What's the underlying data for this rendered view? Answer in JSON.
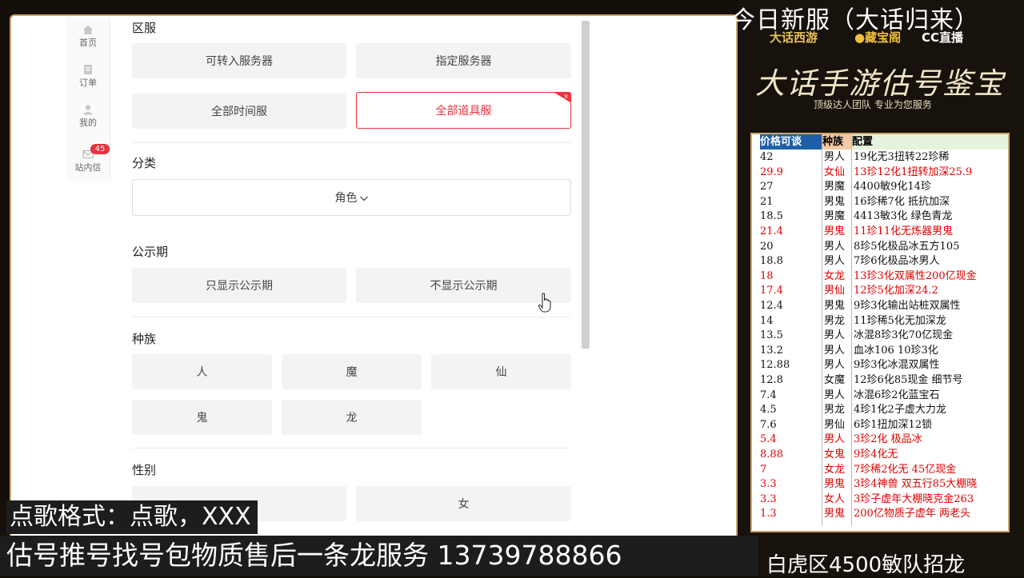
{
  "stream_title": "今日新服（大话归来）",
  "logos": [
    {
      "text": "大话西游",
      "color": "#e8c35a"
    },
    {
      "text": "藏宝阁",
      "color": "#f0c040"
    },
    {
      "text": "CC直播",
      "color": "#ffffff"
    }
  ],
  "brand_title": "大话手游估号鉴宝",
  "brand_subtitle": "顶级达人团队 专业为您服务",
  "nav": {
    "items": [
      {
        "label": "首页",
        "icon": "home-icon"
      },
      {
        "label": "订单",
        "icon": "order-icon"
      },
      {
        "label": "我的",
        "icon": "user-icon"
      },
      {
        "label": "站内信",
        "icon": "mail-icon",
        "badge": "45"
      }
    ]
  },
  "filters": {
    "server": {
      "title": "区服",
      "options": [
        "可转入服务器",
        "指定服务器",
        "全部时间服",
        "全部道具服"
      ],
      "selected": "全部道具服",
      "selected_mark": "×"
    },
    "category": {
      "title": "分类",
      "value": "角色"
    },
    "public_period": {
      "title": "公示期",
      "options": [
        "只显示公示期",
        "不显示公示期"
      ]
    },
    "race": {
      "title": "种族",
      "options": [
        "人",
        "魔",
        "仙",
        "鬼",
        "龙"
      ]
    },
    "gender": {
      "title": "性别",
      "options": [
        "女"
      ]
    }
  },
  "price_table": {
    "headers": [
      "价格可谈",
      "种族",
      "配置"
    ],
    "header_colors": [
      "#1d5fa8",
      "#f5c9a6",
      "#e6f3dc"
    ],
    "highlight_color": "#e00000",
    "rows": [
      {
        "price": "42",
        "race": "男人",
        "config": "19化无3扭转22珍稀",
        "red": false
      },
      {
        "price": "29.9",
        "race": "女仙",
        "config": "13珍12化1扭转加深25.9",
        "red": true
      },
      {
        "price": "27",
        "race": "男魔",
        "config": "4400敏9化14珍",
        "red": false
      },
      {
        "price": "21",
        "race": "男鬼",
        "config": "16珍稀7化 抵抗加深",
        "red": false
      },
      {
        "price": "18.5",
        "race": "男魔",
        "config": "4413敏3化 绿色青龙",
        "red": false
      },
      {
        "price": "21.4",
        "race": "男鬼",
        "config": "11珍11化无炼器男鬼",
        "red": true
      },
      {
        "price": "20",
        "race": "男人",
        "config": "8珍5化极品冰五方105",
        "red": false
      },
      {
        "price": "18.8",
        "race": "男人",
        "config": "7珍6化极品冰男人",
        "red": false
      },
      {
        "price": "18",
        "race": "女龙",
        "config": "13珍3化双属性200亿现金",
        "red": true
      },
      {
        "price": "17.4",
        "race": "男仙",
        "config": "12珍5化加深24.2",
        "red": true
      },
      {
        "price": "12.4",
        "race": "男鬼",
        "config": "9珍3化输出站桩双属性",
        "red": false
      },
      {
        "price": "14",
        "race": "男龙",
        "config": "11珍稀5化无加深龙",
        "red": false
      },
      {
        "price": "13.5",
        "race": "男人",
        "config": "冰混8珍3化70亿现金",
        "red": false
      },
      {
        "price": "13.2",
        "race": "男人",
        "config": "血冰106 10珍3化",
        "red": false
      },
      {
        "price": "12.88",
        "race": "男人",
        "config": "9珍3化冰混双属性",
        "red": false
      },
      {
        "price": "12.8",
        "race": "女魔",
        "config": "12珍6化85现金 细节号",
        "red": false
      },
      {
        "price": "7.4",
        "race": "男人",
        "config": "冰混6珍2化蓝宝石",
        "red": false
      },
      {
        "price": "4.5",
        "race": "男龙",
        "config": "4珍1化2子虚大力龙",
        "red": false
      },
      {
        "price": "7.6",
        "race": "男仙",
        "config": "6珍1扭加深12锁",
        "red": false
      },
      {
        "price": "5.4",
        "race": "男人",
        "config": "3珍2化 极品冰",
        "red": true
      },
      {
        "price": "8.88",
        "race": "女鬼",
        "config": "9珍4化无",
        "red": true
      },
      {
        "price": "7",
        "race": "女龙",
        "config": "7珍稀2化无 45亿现金",
        "red": true
      },
      {
        "price": "3.3",
        "race": "男鬼",
        "config": "3珍4神兽 双五行85大棚晓",
        "red": true
      },
      {
        "price": "3.3",
        "race": "女人",
        "config": "3珍子虚年大棚晓克金263",
        "red": true
      },
      {
        "price": "1.3",
        "race": "男鬼",
        "config": "200亿物质子虚年 两老头",
        "red": true
      }
    ]
  },
  "recruit_text": "白虎区4500敏队招龙",
  "song_format": "点歌格式：点歌，XXX",
  "service_line": "估号推号找号包物质售后一条龙服务 13739788866"
}
